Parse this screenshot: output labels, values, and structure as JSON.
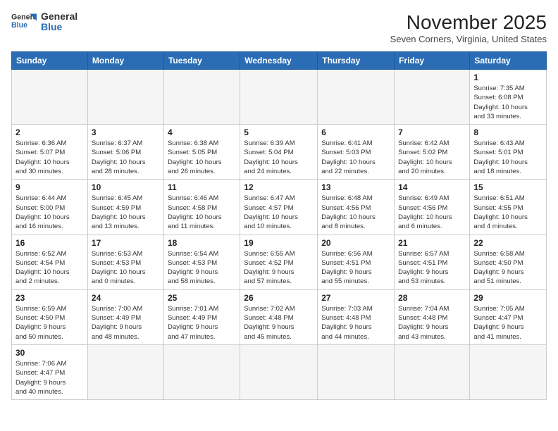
{
  "header": {
    "logo_line1": "General",
    "logo_line2": "Blue",
    "month_title": "November 2025",
    "location": "Seven Corners, Virginia, United States"
  },
  "weekdays": [
    "Sunday",
    "Monday",
    "Tuesday",
    "Wednesday",
    "Thursday",
    "Friday",
    "Saturday"
  ],
  "weeks": [
    [
      {
        "day": "",
        "info": ""
      },
      {
        "day": "",
        "info": ""
      },
      {
        "day": "",
        "info": ""
      },
      {
        "day": "",
        "info": ""
      },
      {
        "day": "",
        "info": ""
      },
      {
        "day": "",
        "info": ""
      },
      {
        "day": "1",
        "info": "Sunrise: 7:35 AM\nSunset: 6:08 PM\nDaylight: 10 hours\nand 33 minutes."
      }
    ],
    [
      {
        "day": "2",
        "info": "Sunrise: 6:36 AM\nSunset: 5:07 PM\nDaylight: 10 hours\nand 30 minutes."
      },
      {
        "day": "3",
        "info": "Sunrise: 6:37 AM\nSunset: 5:06 PM\nDaylight: 10 hours\nand 28 minutes."
      },
      {
        "day": "4",
        "info": "Sunrise: 6:38 AM\nSunset: 5:05 PM\nDaylight: 10 hours\nand 26 minutes."
      },
      {
        "day": "5",
        "info": "Sunrise: 6:39 AM\nSunset: 5:04 PM\nDaylight: 10 hours\nand 24 minutes."
      },
      {
        "day": "6",
        "info": "Sunrise: 6:41 AM\nSunset: 5:03 PM\nDaylight: 10 hours\nand 22 minutes."
      },
      {
        "day": "7",
        "info": "Sunrise: 6:42 AM\nSunset: 5:02 PM\nDaylight: 10 hours\nand 20 minutes."
      },
      {
        "day": "8",
        "info": "Sunrise: 6:43 AM\nSunset: 5:01 PM\nDaylight: 10 hours\nand 18 minutes."
      }
    ],
    [
      {
        "day": "9",
        "info": "Sunrise: 6:44 AM\nSunset: 5:00 PM\nDaylight: 10 hours\nand 16 minutes."
      },
      {
        "day": "10",
        "info": "Sunrise: 6:45 AM\nSunset: 4:59 PM\nDaylight: 10 hours\nand 13 minutes."
      },
      {
        "day": "11",
        "info": "Sunrise: 6:46 AM\nSunset: 4:58 PM\nDaylight: 10 hours\nand 11 minutes."
      },
      {
        "day": "12",
        "info": "Sunrise: 6:47 AM\nSunset: 4:57 PM\nDaylight: 10 hours\nand 10 minutes."
      },
      {
        "day": "13",
        "info": "Sunrise: 6:48 AM\nSunset: 4:56 PM\nDaylight: 10 hours\nand 8 minutes."
      },
      {
        "day": "14",
        "info": "Sunrise: 6:49 AM\nSunset: 4:56 PM\nDaylight: 10 hours\nand 6 minutes."
      },
      {
        "day": "15",
        "info": "Sunrise: 6:51 AM\nSunset: 4:55 PM\nDaylight: 10 hours\nand 4 minutes."
      }
    ],
    [
      {
        "day": "16",
        "info": "Sunrise: 6:52 AM\nSunset: 4:54 PM\nDaylight: 10 hours\nand 2 minutes."
      },
      {
        "day": "17",
        "info": "Sunrise: 6:53 AM\nSunset: 4:53 PM\nDaylight: 10 hours\nand 0 minutes."
      },
      {
        "day": "18",
        "info": "Sunrise: 6:54 AM\nSunset: 4:53 PM\nDaylight: 9 hours\nand 58 minutes."
      },
      {
        "day": "19",
        "info": "Sunrise: 6:55 AM\nSunset: 4:52 PM\nDaylight: 9 hours\nand 57 minutes."
      },
      {
        "day": "20",
        "info": "Sunrise: 6:56 AM\nSunset: 4:51 PM\nDaylight: 9 hours\nand 55 minutes."
      },
      {
        "day": "21",
        "info": "Sunrise: 6:57 AM\nSunset: 4:51 PM\nDaylight: 9 hours\nand 53 minutes."
      },
      {
        "day": "22",
        "info": "Sunrise: 6:58 AM\nSunset: 4:50 PM\nDaylight: 9 hours\nand 51 minutes."
      }
    ],
    [
      {
        "day": "23",
        "info": "Sunrise: 6:59 AM\nSunset: 4:50 PM\nDaylight: 9 hours\nand 50 minutes."
      },
      {
        "day": "24",
        "info": "Sunrise: 7:00 AM\nSunset: 4:49 PM\nDaylight: 9 hours\nand 48 minutes."
      },
      {
        "day": "25",
        "info": "Sunrise: 7:01 AM\nSunset: 4:49 PM\nDaylight: 9 hours\nand 47 minutes."
      },
      {
        "day": "26",
        "info": "Sunrise: 7:02 AM\nSunset: 4:48 PM\nDaylight: 9 hours\nand 45 minutes."
      },
      {
        "day": "27",
        "info": "Sunrise: 7:03 AM\nSunset: 4:48 PM\nDaylight: 9 hours\nand 44 minutes."
      },
      {
        "day": "28",
        "info": "Sunrise: 7:04 AM\nSunset: 4:48 PM\nDaylight: 9 hours\nand 43 minutes."
      },
      {
        "day": "29",
        "info": "Sunrise: 7:05 AM\nSunset: 4:47 PM\nDaylight: 9 hours\nand 41 minutes."
      }
    ],
    [
      {
        "day": "30",
        "info": "Sunrise: 7:06 AM\nSunset: 4:47 PM\nDaylight: 9 hours\nand 40 minutes."
      },
      {
        "day": "",
        "info": ""
      },
      {
        "day": "",
        "info": ""
      },
      {
        "day": "",
        "info": ""
      },
      {
        "day": "",
        "info": ""
      },
      {
        "day": "",
        "info": ""
      },
      {
        "day": "",
        "info": ""
      }
    ]
  ]
}
